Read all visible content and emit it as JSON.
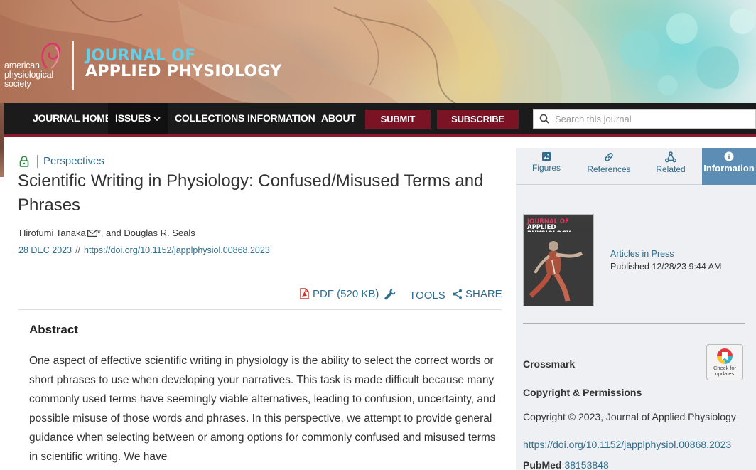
{
  "header": {
    "society_lines": [
      "american",
      "physiological",
      "society"
    ],
    "journal_line1": "JOURNAL OF",
    "journal_line2": "APPLIED PHYSIOLOGY"
  },
  "nav": {
    "items": [
      "JOURNAL HOME",
      "ISSUES",
      "COLLECTIONS",
      "INFORMATION",
      "ABOUT"
    ],
    "submit_label": "SUBMIT",
    "subscribe_label": "SUBSCRIBE",
    "search_placeholder": "Search this journal"
  },
  "article": {
    "category": "Perspectives",
    "title": "Scientific Writing in Physiology: Confused/Misused Terms and Phrases",
    "author1": "Hirofumi Tanaka",
    "author_suffix": "*, and",
    "author2": "Douglas R. Seals",
    "date": "28 DEC 2023",
    "date_sep": "//",
    "doi": "https://doi.org/10.1152/japplphysiol.00868.2023",
    "pdf_label": "PDF (520 KB)",
    "tools_label": "TOOLS",
    "share_label": "SHARE",
    "abstract_heading": "Abstract",
    "abstract_text": "One aspect of effective scientific writing in physiology is the ability to select the correct words or short phrases to use when developing your narratives. This task is made difficult because many commonly used terms have seemingly viable alternatives, leading to confusion, uncertainty, and possible misuse of those words and phrases. In this perspective, we attempt to provide general guidance when selecting between or among options for commonly confused and misused terms in scientific writing. We have"
  },
  "sidebar": {
    "tabs": [
      "Figures",
      "References",
      "Related",
      "Information"
    ],
    "cover_line1": "JOURNAL OF",
    "cover_line2": "APPLIED PHYSIOLOGY",
    "status_link": "Articles in Press",
    "published": "Published 12/28/23 9:44 AM",
    "crossmark": "Crossmark",
    "crossmark_badge_line1": "Check for",
    "crossmark_badge_line2": "updates",
    "copyright_heading": "Copyright & Permissions",
    "copyright_text": "Copyright © 2023, Journal of Applied Physiology",
    "doi": "https://doi.org/10.1152/japplphysiol.00868.2023",
    "pubmed_label": "PubMed",
    "pubmed_id": "38153848"
  },
  "colors": {
    "nav_bg": "#1b1b1b",
    "accent_red": "#7a1424",
    "link_blue": "#2f6d8e",
    "tab_active": "#5b8db5",
    "panel_bg": "#eef0f3"
  },
  "icons": [
    "lock-icon",
    "mail-icon",
    "pdf-icon",
    "wrench-icon",
    "share-icon",
    "search-icon",
    "image-icon",
    "link-icon",
    "network-icon",
    "info-icon",
    "chevron-down-icon"
  ]
}
